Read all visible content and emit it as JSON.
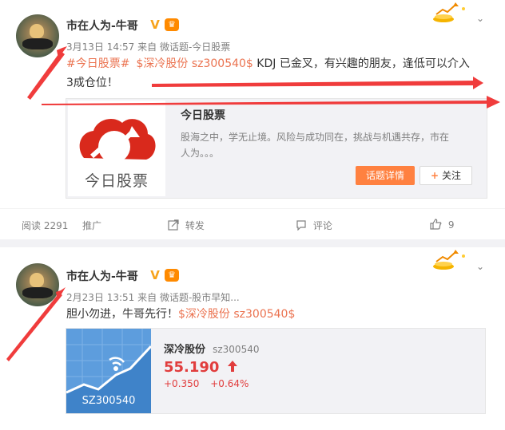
{
  "post1": {
    "username": "市在人为-牛哥",
    "verified_icon": "verified-v-icon",
    "vip_icon": "crown-icon",
    "timestamp": "3月13日 14:57",
    "source": "来自 微话题-今日股票",
    "content": {
      "hashtag": "#今日股票#",
      "stock": "$深冷股份 sz300540$",
      "text_line1": " KDJ 已金叉，有兴趣的朋友，逢低可以介入",
      "text_line2": "3成仓位！"
    },
    "card": {
      "logo_text": "今日股票",
      "title": "今日股票",
      "desc_line1": "股海之中，学无止境。风险与成功同在，挑战与机遇共存，市在",
      "desc_line2": "人为。。。",
      "detail_button": "话题详情",
      "follow_button": "关注",
      "follow_icon": "plus-icon"
    },
    "actions": {
      "read_label": "阅读 2291",
      "promote_label": "推广",
      "repost_label": "转发",
      "comment_label": "评论",
      "like_count": "9"
    }
  },
  "post2": {
    "username": "市在人为-牛哥",
    "timestamp": "2月23日 13:51",
    "source": "来自 微话题-股市早知...",
    "content": {
      "text": "胆小勿进，牛哥先行！",
      "stock": "$深冷股份 sz300540$"
    },
    "stock_card": {
      "thumb_label": "SZ300540",
      "name": "深冷股份",
      "code": "sz300540",
      "price": "55.190",
      "change": "+0.350",
      "change_pct": "+0.64%"
    }
  },
  "colors": {
    "link": "#eb7350",
    "accent_orange": "#ff8140",
    "price_red": "#e13d3d",
    "annotation_red": "#f03c3c"
  }
}
